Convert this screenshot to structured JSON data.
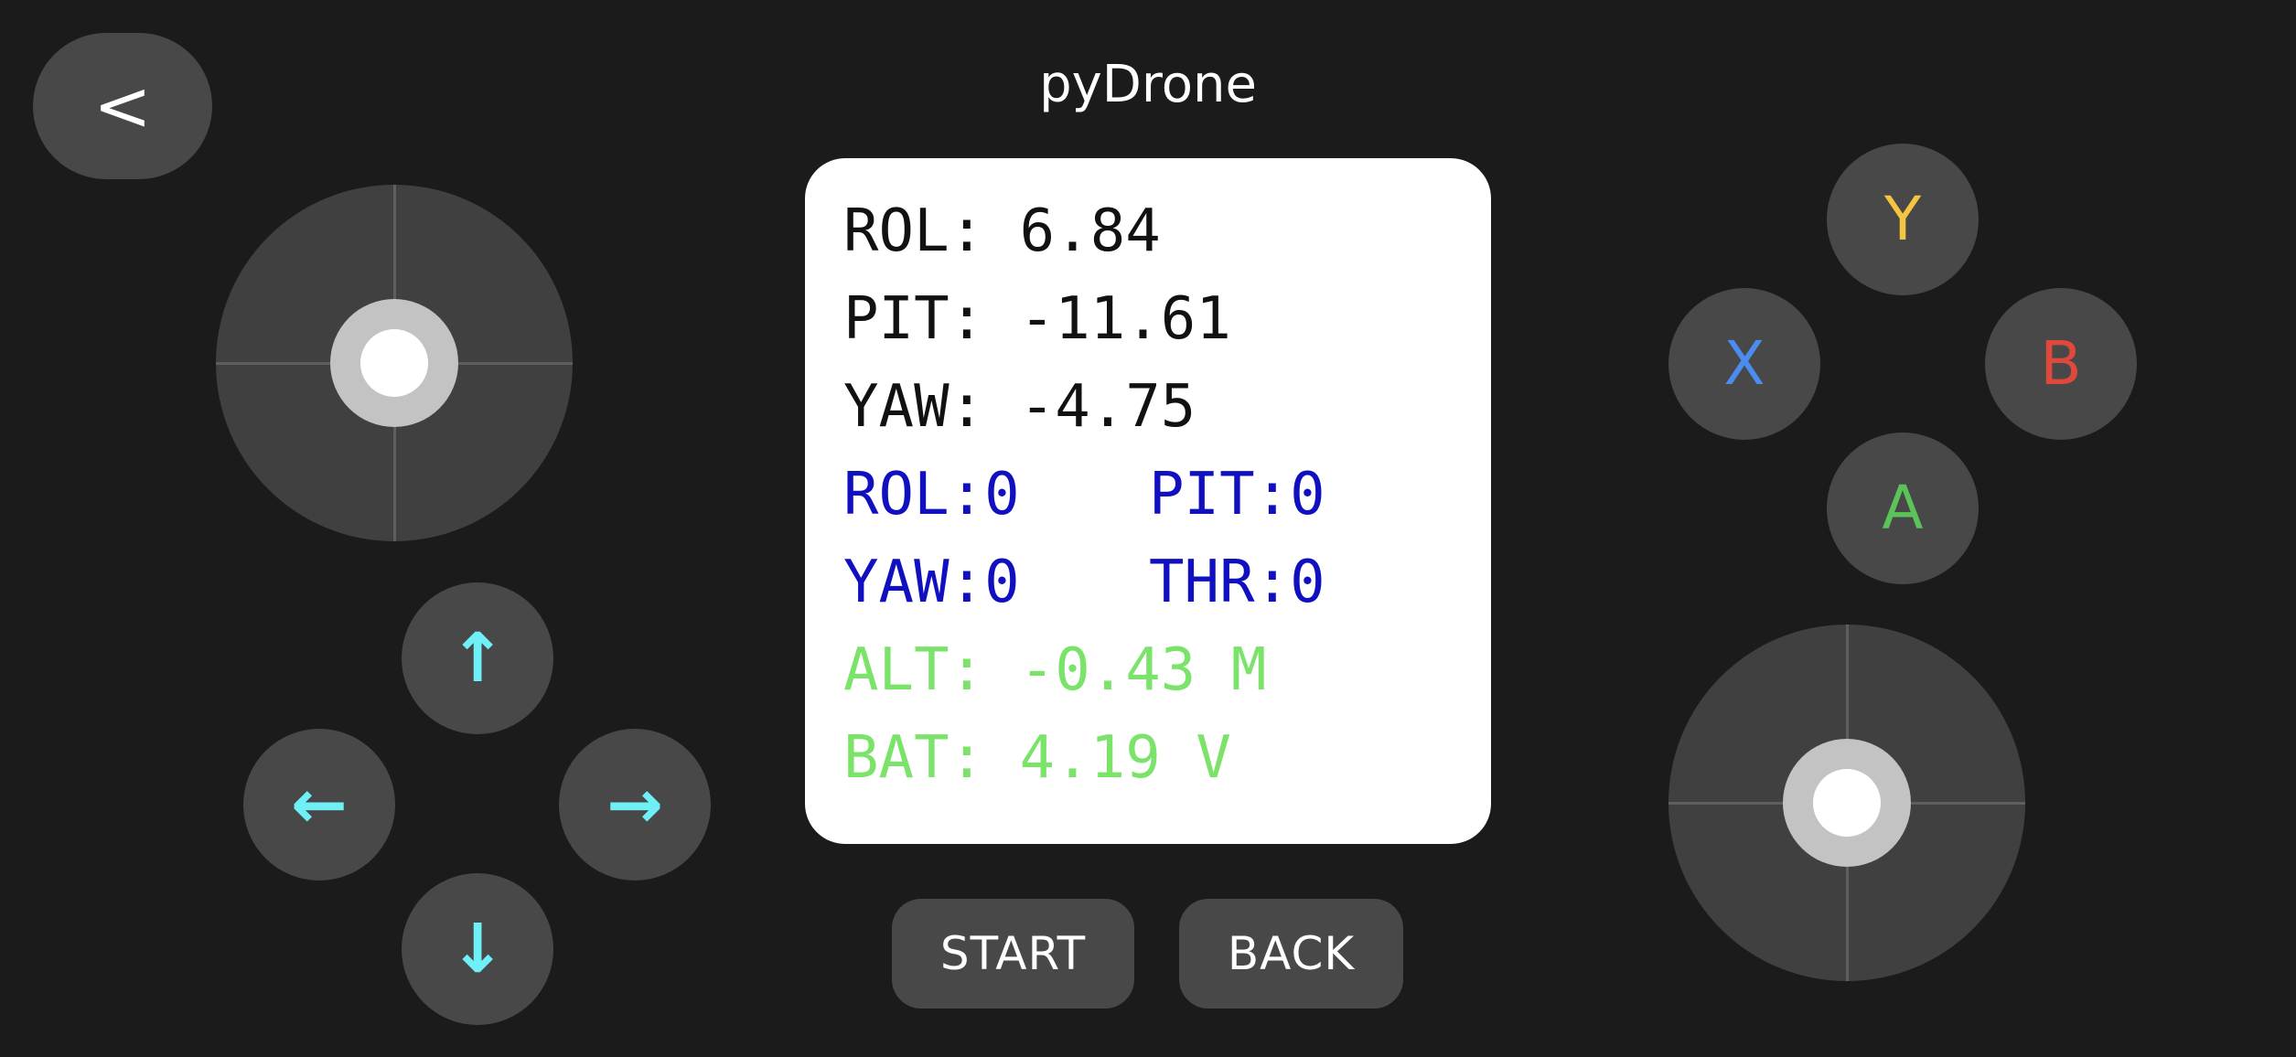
{
  "app": {
    "title": "pyDrone",
    "back_label": "<"
  },
  "dpad": {
    "up": "↑",
    "left": "←",
    "right": "→",
    "down": "↓"
  },
  "face_buttons": {
    "y": {
      "label": "Y",
      "color": "#f5c542"
    },
    "x": {
      "label": "X",
      "color": "#4a8cf0"
    },
    "b": {
      "label": "B",
      "color": "#e0483c"
    },
    "a": {
      "label": "A",
      "color": "#5cc25a"
    }
  },
  "telemetry": {
    "rol": "ROL: 6.84",
    "pit": "PIT: -11.61",
    "yaw": "YAW: -4.75",
    "ctrl_rol": "ROL:0",
    "ctrl_pit": "PIT:0",
    "ctrl_yaw": "YAW:0",
    "ctrl_thr": "THR:0",
    "alt": "ALT: -0.43 M",
    "bat": "BAT: 4.19 V"
  },
  "bottom_buttons": {
    "start": "START",
    "back": "BACK"
  },
  "colors": {
    "background": "#1b1b1b",
    "button": "#484848",
    "arrow": "#6ff0f6",
    "telemetry_black": "#111111",
    "telemetry_blue": "#1010c0",
    "telemetry_green": "#7be36a"
  },
  "icons": {
    "back": "chevron-left-icon",
    "up": "arrow-up-icon",
    "down": "arrow-down-icon",
    "left": "arrow-left-icon",
    "right": "arrow-right-icon"
  }
}
